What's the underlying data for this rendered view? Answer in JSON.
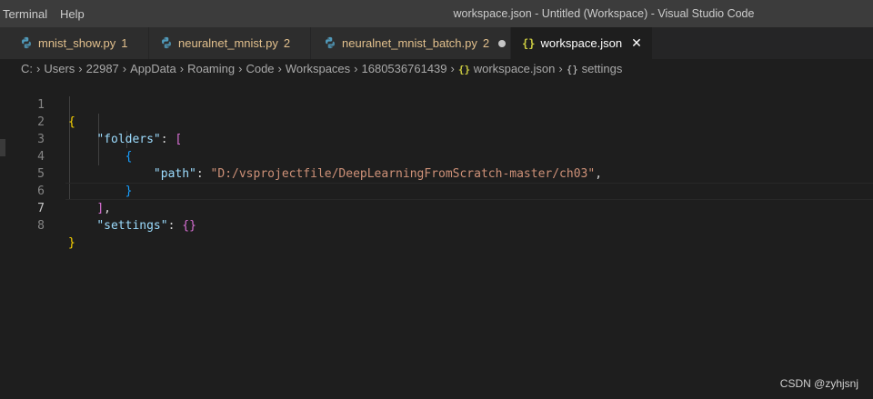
{
  "menubar": {
    "items": [
      "Terminal",
      "Help"
    ]
  },
  "window_title": "workspace.json - Untitled (Workspace) - Visual Studio Code",
  "tabs": [
    {
      "label": "mnist_show.py",
      "count": "1",
      "icon": "python-icon"
    },
    {
      "label": "neuralnet_mnist.py",
      "count": "2",
      "icon": "python-icon"
    },
    {
      "label": "neuralnet_mnist_batch.py",
      "count": "2",
      "icon": "python-icon",
      "modified": true
    },
    {
      "label": "workspace.json",
      "icon": "json-icon",
      "active": true,
      "close": "✕"
    }
  ],
  "breadcrumb": {
    "segments": [
      "C:",
      "Users",
      "22987",
      "AppData",
      "Roaming",
      "Code",
      "Workspaces",
      "1680536761439"
    ],
    "file": "workspace.json",
    "file_icon": "{}",
    "symbol": "settings",
    "symbol_icon": "{}"
  },
  "editor": {
    "active_line": "7",
    "line_numbers": [
      "1",
      "2",
      "3",
      "4",
      "5",
      "6",
      "7",
      "8"
    ],
    "tokens": {
      "open_brace": "{",
      "folders_key": "\"folders\"",
      "colon": ":",
      "open_bracket": "[",
      "inner_open": "{",
      "path_key": "\"path\"",
      "path_value": "\"D:/vsprojectfile/DeepLearningFromScratch-master/ch03\"",
      "comma": ",",
      "inner_close": "}",
      "close_bracket": "]",
      "settings_key": "\"settings\"",
      "settings_value": "{}",
      "close_brace": "}"
    }
  },
  "watermark": "CSDN @zyhjsnj",
  "colors": {
    "background": "#1e1e1e",
    "key": "#9cdcfe",
    "string": "#ce9178",
    "bracket_level1": "#ffd700",
    "bracket_level2": "#da70d6",
    "bracket_level3": "#179fff",
    "modified_tab_label": "#e2c08d"
  }
}
